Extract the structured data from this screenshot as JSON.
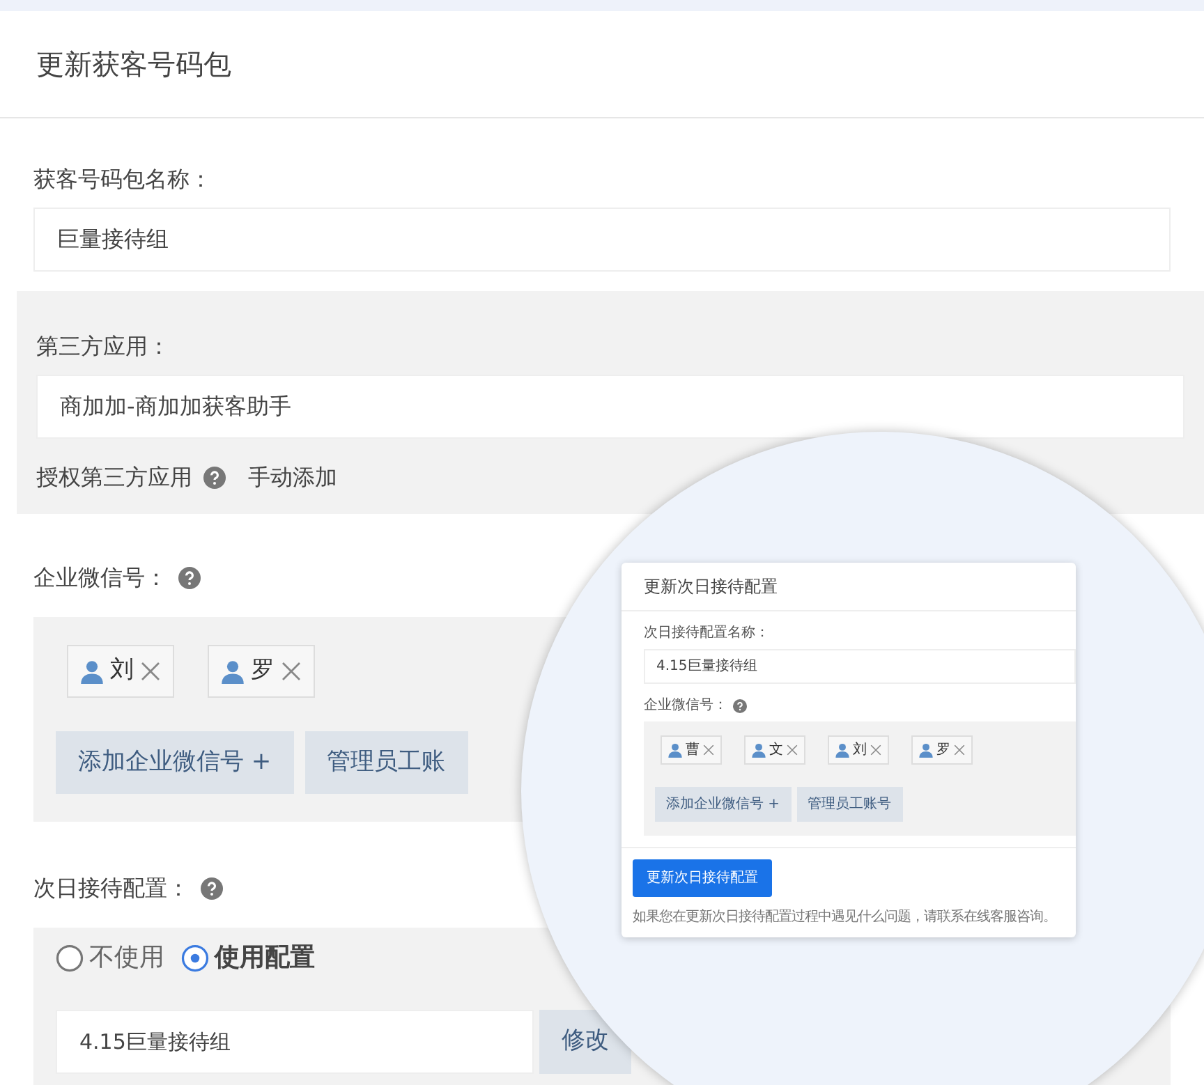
{
  "page": {
    "title": "更新获客号码包"
  },
  "package_name": {
    "label": "获客号码包名称：",
    "value": "巨量接待组"
  },
  "third_party": {
    "label": "第三方应用：",
    "value": "商加加-商加加获客助手",
    "authorize_label": "授权第三方应用",
    "manual_add_link": "手动添加"
  },
  "wecom": {
    "label": "企业微信号：",
    "tags": [
      {
        "name": "刘"
      },
      {
        "name": "罗"
      }
    ],
    "buttons": [
      "添加企业微信号 +",
      "管理员工账"
    ]
  },
  "next_day": {
    "label": "次日接待配置：",
    "options": [
      {
        "label": "不使用",
        "selected": false
      },
      {
        "label": "使用配置",
        "selected": true
      }
    ],
    "value": "4.15巨量接待组",
    "edit_button": "修改"
  },
  "magnifier": {
    "dialog": {
      "title": "更新次日接待配置",
      "name_label": "次日接待配置名称：",
      "name_value": "4.15巨量接待组",
      "wecom_label": "企业微信号：",
      "tags": [
        {
          "name": "曹"
        },
        {
          "name": "文"
        },
        {
          "name": "刘"
        },
        {
          "name": "罗"
        }
      ],
      "buttons": [
        "添加企业微信号 +",
        "管理员工账号"
      ],
      "submit_button": "更新次日接待配置",
      "note": "如果您在更新次日接待配置过程中遇见什么问题，请联系在线客服咨询。"
    }
  }
}
